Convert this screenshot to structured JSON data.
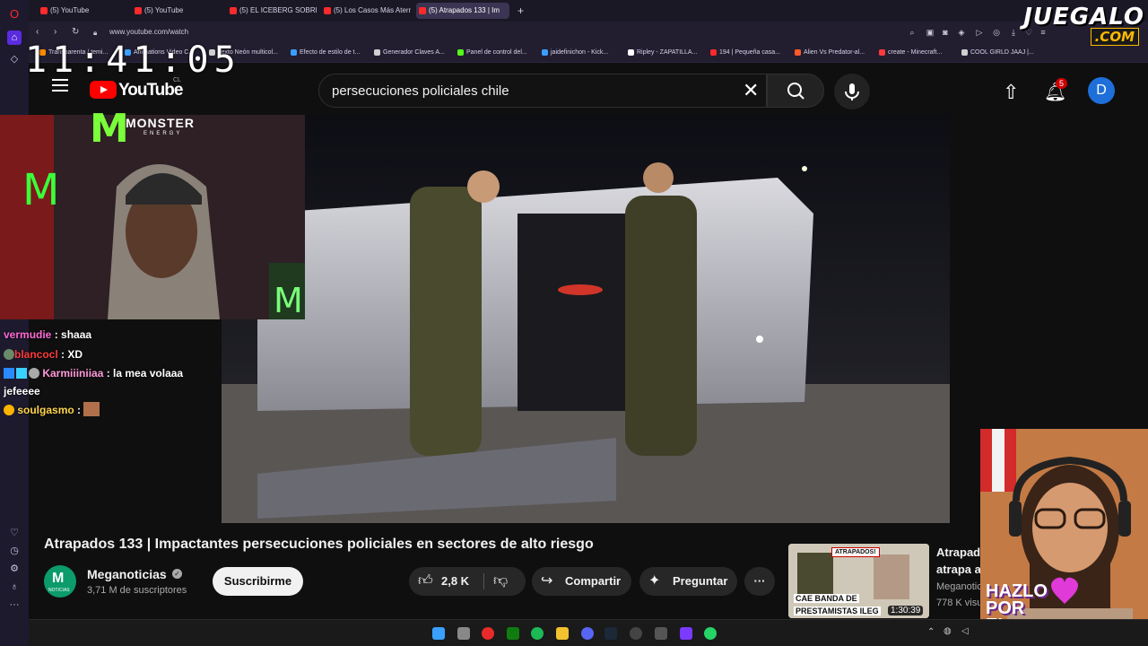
{
  "browser": {
    "tabs": [
      {
        "label": "(5) YouTube",
        "active": false
      },
      {
        "label": "(5) YouTube",
        "active": false
      },
      {
        "label": "(5) EL ICEBERG SOBRE CH",
        "active": false
      },
      {
        "label": "(5) Los Casos Más Aterrad",
        "active": false
      },
      {
        "label": "(5) Atrapados 133 | Im",
        "active": true
      }
    ],
    "new_tab": "+",
    "url": "www.youtube.com/watch",
    "bookmarks": [
      {
        "label": "Transparenta / temi...",
        "color": "#ff8a00"
      },
      {
        "label": "Animations Video C...",
        "color": "#3aa0ff"
      },
      {
        "label": "Texto Neón multicol...",
        "color": "#d0d0d0"
      },
      {
        "label": "Efecto de estilo de t...",
        "color": "#3aa0ff"
      },
      {
        "label": "Generador Claves A...",
        "color": "#d0d0d0"
      },
      {
        "label": "Panel de control del...",
        "color": "#53fc18"
      },
      {
        "label": "jaidefinichon - Kick...",
        "color": "#3aa0ff"
      },
      {
        "label": "Ripley - ZAPATILLA...",
        "color": "#ffffff"
      },
      {
        "label": "194 | Pequeña casa...",
        "color": "#ff2a2a"
      },
      {
        "label": "Alien Vs Predator-al...",
        "color": "#ff5a2a"
      },
      {
        "label": "create - Minecraft...",
        "color": "#ff3b3b"
      },
      {
        "label": "COOL GIRLD JAAJ |...",
        "color": "#d0d0d0"
      }
    ]
  },
  "overlay": {
    "clock": "11:41:05",
    "brand_top": "JUEGALO",
    "brand_bottom": ".COM",
    "sponsor": "MONSTER",
    "sponsor_sub": "ENERGY",
    "hazlo": [
      "HAZLO",
      "POR",
      "EL"
    ]
  },
  "chat": [
    {
      "user": "vermudie",
      "msg": "shaaa",
      "color": "#ff6ad5"
    },
    {
      "user": "blancocl",
      "msg": "XD",
      "color": "#ff3b3b"
    },
    {
      "user": "Karmiiiniiaa",
      "msg": "la mea volaaa jefeeee",
      "color": "#ff9ad9"
    },
    {
      "user": "soulgasmo",
      "msg": "",
      "color": "#ffd54a"
    }
  ],
  "youtube": {
    "logo_text": "YouTube",
    "country": "CL",
    "search_value": "persecuciones policiales chile",
    "notif_count": "5",
    "avatar_letter": "D",
    "video_title": "Atrapados 133 | Impactantes persecuciones policiales en sectores de alto riesgo",
    "channel_name": "Meganoticias",
    "channel_subs": "3,71 M de suscriptores",
    "channel_logo_text": "NOTICIAS",
    "subscribe_label": "Suscribirme",
    "likes": "2,8 K",
    "share_label": "Compartir",
    "ask_label": "Preguntar",
    "related": {
      "badge": "ATRAPADOS!",
      "caption_1": "CAE BANDA DE",
      "caption_2": "PRESTAMISTAS ILEG",
      "duration": "1:30:39",
      "title_1": "Atrapad",
      "title_2": "atrapa a",
      "channel": "Meganotic",
      "views": "778 K visu"
    }
  }
}
